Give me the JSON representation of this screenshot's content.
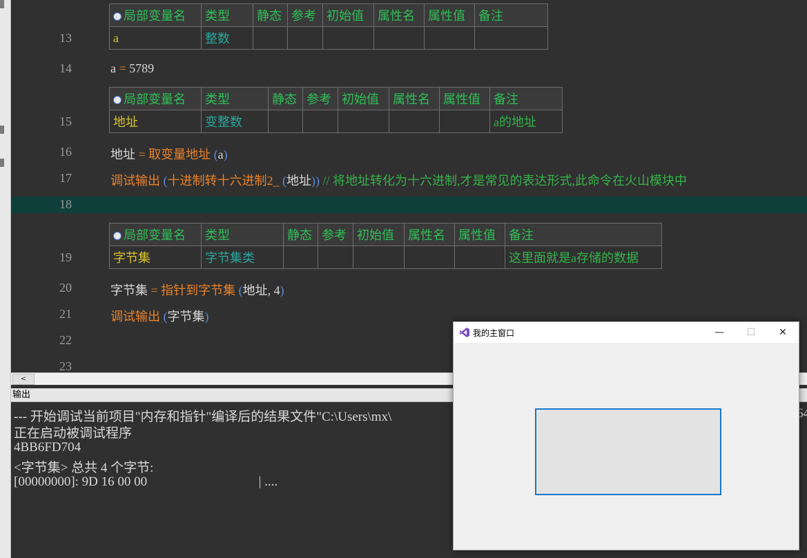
{
  "code": {
    "lines": {
      "l13": "13",
      "l14": "14",
      "l15": "15",
      "l16": "16",
      "l17": "17",
      "l18": "18",
      "l19": "19",
      "l20": "20",
      "l21": "21",
      "l22": "22",
      "l23": "23"
    },
    "table_headers": {
      "name": "局部变量名",
      "type": "类型",
      "static": "静态",
      "ref": "参考",
      "init": "初始值",
      "prop_name": "属性名",
      "prop_value": "属性值",
      "remark": "备注"
    },
    "table1": {
      "name": "a",
      "type": "整数",
      "remark": ""
    },
    "line14": {
      "var": "a",
      "op": "=",
      "value": "5789"
    },
    "table2": {
      "name": "地址",
      "type": "变整数",
      "remark": "a的地址"
    },
    "line16": {
      "var": "地址",
      "op": "=",
      "func": "取变量地址",
      "open": "(",
      "arg": "a",
      "close": ")"
    },
    "line17": {
      "func": "调试输出",
      "open": "(",
      "func2": "十进制转十六进制2_",
      "open2": "(",
      "arg": "地址",
      "close": "))",
      "comment": "// 将地址转化为十六进制,才是常见的表达形式,此命令在火山模块中"
    },
    "table3": {
      "name": "字节集",
      "type": "字节集类",
      "remark": "这里面就是a存储的数据"
    },
    "line20": {
      "var": "字节集",
      "op": "=",
      "func": "指针到字节集",
      "open": "(",
      "arg1": "地址",
      "comma": ",",
      "arg2": "4",
      "close": ")"
    },
    "line21": {
      "func": "调试输出",
      "open": "(",
      "arg": "字节集",
      "close": ")"
    }
  },
  "scrollbar": {
    "left_arrow": "<"
  },
  "output": {
    "title": "输出",
    "lines": [
      "--- 开始调试当前项目\"内存和指针\"编译后的结果文件\"C:\\Users\\mx\\",
      "正在启动被调试程序",
      "4BB6FD704",
      "<字节集> 总共 4 个字节:",
      "[00000000]: 9D 16 00 00                                  | ...."
    ],
    "overflow_right": "64"
  },
  "window": {
    "title": "我的主窗口",
    "minimize": "—",
    "maximize": "☐",
    "close": "✕"
  },
  "colors": {
    "editor_bg": "#303030",
    "highlight_line": "#0f3f3a",
    "keyword_orange": "#e8822a",
    "comment_green": "#34b24a",
    "accent_blue": "#1976c8"
  }
}
